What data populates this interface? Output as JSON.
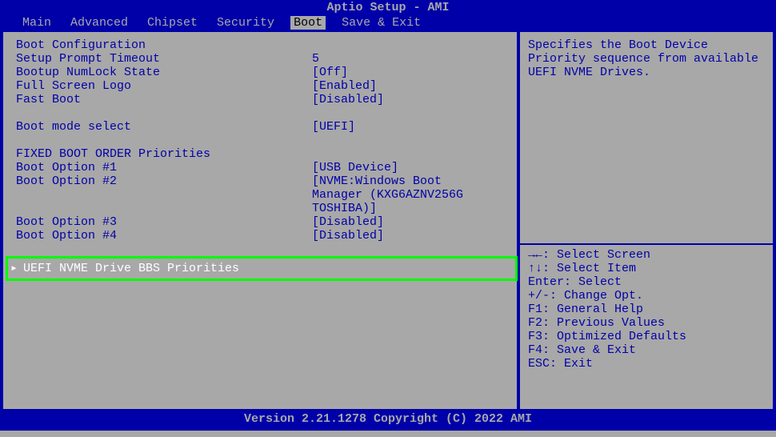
{
  "title": "Aptio Setup - AMI",
  "menu": {
    "items": [
      "Main",
      "Advanced",
      "Chipset",
      "Security",
      "Boot",
      "Save & Exit"
    ],
    "active_index": 4
  },
  "left": {
    "sections": [
      {
        "type": "header",
        "text": "Boot Configuration"
      },
      {
        "type": "row",
        "label": "Setup Prompt Timeout",
        "value": "5"
      },
      {
        "type": "row",
        "label": "Bootup NumLock State",
        "value": "[Off]"
      },
      {
        "type": "row",
        "label": "Full Screen Logo",
        "value": "[Enabled]"
      },
      {
        "type": "row",
        "label": "Fast Boot",
        "value": "[Disabled]"
      },
      {
        "type": "blank"
      },
      {
        "type": "row",
        "label": "Boot mode select",
        "value": "[UEFI]"
      },
      {
        "type": "blank"
      },
      {
        "type": "header",
        "text": "FIXED BOOT ORDER Priorities"
      },
      {
        "type": "row",
        "label": "Boot Option #1",
        "value": "[USB Device]"
      },
      {
        "type": "row",
        "label": "Boot Option #2",
        "value": "[NVME:Windows Boot"
      },
      {
        "type": "row",
        "label": "",
        "value": "Manager (KXG6AZNV256G"
      },
      {
        "type": "row",
        "label": "",
        "value": "TOSHIBA)]"
      },
      {
        "type": "row",
        "label": "Boot Option #3",
        "value": "[Disabled]"
      },
      {
        "type": "row",
        "label": "Boot Option #4",
        "value": "[Disabled]"
      }
    ],
    "submenu": {
      "arrow": "▸",
      "label": "UEFI NVME Drive BBS Priorities"
    }
  },
  "right": {
    "help": "Specifies the Boot Device Priority sequence from available UEFI NVME Drives.",
    "keys": [
      "→←: Select Screen",
      "↑↓: Select Item",
      "Enter: Select",
      "+/-: Change Opt.",
      "F1: General Help",
      "F2: Previous Values",
      "F3: Optimized Defaults",
      "F4: Save & Exit",
      "ESC: Exit"
    ]
  },
  "footer": "Version 2.21.1278 Copyright (C) 2022 AMI"
}
